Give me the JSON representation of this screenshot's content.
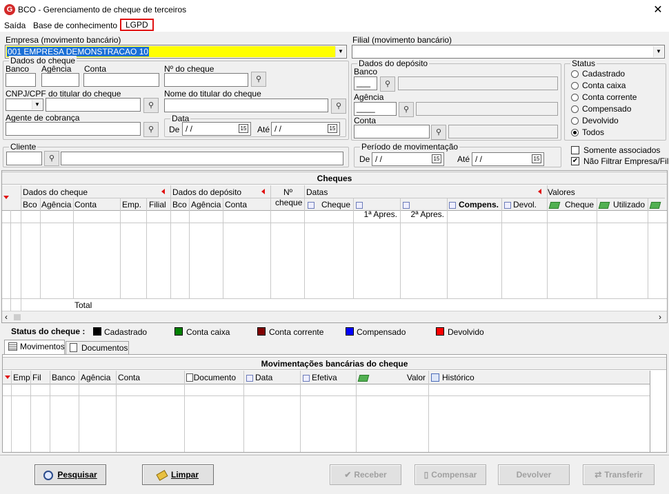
{
  "window": {
    "title": "BCO - Gerenciamento de cheque de terceiros",
    "logo": "G"
  },
  "menu": {
    "saida": "Saída",
    "base": "Base de conhecimento",
    "lgpd": "LGPD"
  },
  "empresa": {
    "label": "Empresa (movimento bancário)",
    "value": "001 EMPRESA DEMONSTRACAO 10"
  },
  "filial": {
    "label": "Filial (movimento bancário)",
    "value": ""
  },
  "dados_cheque": {
    "title": "Dados do cheque",
    "banco": "Banco",
    "agencia": "Agência",
    "conta": "Conta",
    "numero": "Nº do cheque",
    "cnpj": "CNPJ/CPF do titular do cheque",
    "nome": "Nome do titular do cheque",
    "agente": "Agente de cobrança",
    "data": "Data",
    "de": "De",
    "ate": "Até",
    "date_value": " / /"
  },
  "dados_deposito": {
    "title": "Dados do depósito",
    "banco": "Banco",
    "agencia": "Agência",
    "conta": "Conta",
    "banco_mask": "___",
    "agencia_mask": "____"
  },
  "status": {
    "title": "Status",
    "options": [
      "Cadastrado",
      "Conta caixa",
      "Conta corrente",
      "Compensado",
      "Devolvido",
      "Todos"
    ],
    "selected": "Todos"
  },
  "cliente": {
    "label": "Cliente"
  },
  "periodo": {
    "label": "Período de movimentação",
    "de": "De",
    "ate": "Até",
    "date_value": " / /"
  },
  "checks": {
    "somente": "Somente associados",
    "nao_filtrar": "Não Filtrar Empresa/Filial"
  },
  "cheques": {
    "title": "Cheques",
    "group_dados": "Dados do cheque",
    "group_deposito": "Dados do depósito",
    "group_num_1": "Nº",
    "group_num_2": "cheque",
    "group_datas": "Datas",
    "group_valores": "Valores",
    "cols": {
      "bco": "Bco",
      "agencia": "Agência",
      "conta": "Conta",
      "emp": "Emp.",
      "filial": "Filial",
      "bco2": "Bco",
      "agencia2": "Agência",
      "conta2": "Conta",
      "d_cheque": "Cheque",
      "d_1apres": "1ª Apres.",
      "d_2apres": "2ª Apres.",
      "d_compens": "Compens.",
      "d_devol": "Devol.",
      "v_cheque": "Cheque",
      "v_utilizado": "Utilizado"
    },
    "total": "Total"
  },
  "legend": {
    "label": "Status do cheque :",
    "items": [
      {
        "name": "Cadastrado",
        "color": "#000000"
      },
      {
        "name": "Conta caixa",
        "color": "#008000"
      },
      {
        "name": "Conta corrente",
        "color": "#800000"
      },
      {
        "name": "Compensado",
        "color": "#0000ff"
      },
      {
        "name": "Devolvido",
        "color": "#ff0000"
      }
    ]
  },
  "tabs": {
    "movimentos": "Movimentos",
    "documentos": "Documentos"
  },
  "movimentacoes": {
    "title": "Movimentações bancárias do cheque",
    "cols": {
      "emp": "Emp",
      "fil": "Fil",
      "banco": "Banco",
      "agencia": "Agência",
      "conta": "Conta",
      "documento": "Documento",
      "data": "Data",
      "efetiva": "Efetiva",
      "valor": "Valor",
      "historico": "Histórico"
    }
  },
  "buttons": {
    "pesquisar": "Pesquisar",
    "limpar": "Limpar",
    "receber": "Receber",
    "compensar": "Compensar",
    "devolver": "Devolver",
    "transferir": "Transferir"
  }
}
